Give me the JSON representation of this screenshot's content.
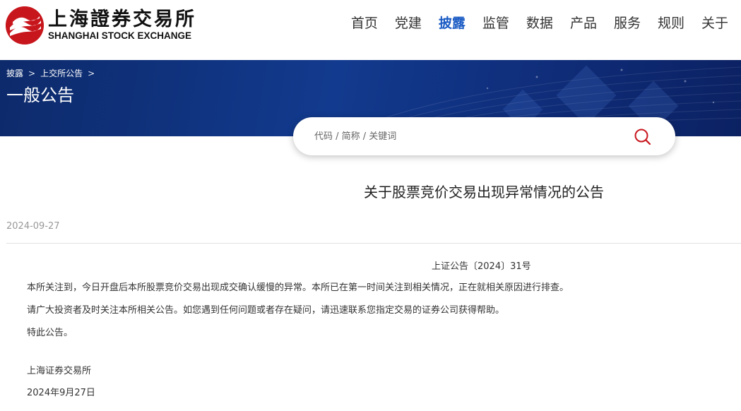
{
  "logo": {
    "cn": "上海證券交易所",
    "en": "SHANGHAI STOCK EXCHANGE"
  },
  "nav": {
    "items": [
      "首页",
      "党建",
      "披露",
      "监管",
      "数据",
      "产品",
      "服务",
      "规则",
      "关于"
    ],
    "active_index": 2
  },
  "breadcrumb": {
    "items": [
      "披露",
      "上交所公告"
    ]
  },
  "page_title": "一般公告",
  "search": {
    "placeholder": "代码 / 简称 / 关键词"
  },
  "article": {
    "title": "关于股票竞价交易出现异常情况的公告",
    "date": "2024-09-27",
    "doc_number": "上证公告〔2024〕31号",
    "paragraphs": [
      "本所关注到，今日开盘后本所股票竞价交易出现成交确认缓慢的异常。本所已在第一时间关注到相关情况，正在就相关原因进行排查。",
      "请广大投资者及时关注本所相关公告。如您遇到任何问题或者存在疑问，请迅速联系您指定交易的证券公司获得帮助。",
      "特此公告。"
    ],
    "signer": "上海证券交易所",
    "sign_date": "2024年9月27日"
  },
  "colors": {
    "brand_red": "#c8161d",
    "nav_active": "#1a5bc4",
    "banner_blue": "#123a8e"
  }
}
